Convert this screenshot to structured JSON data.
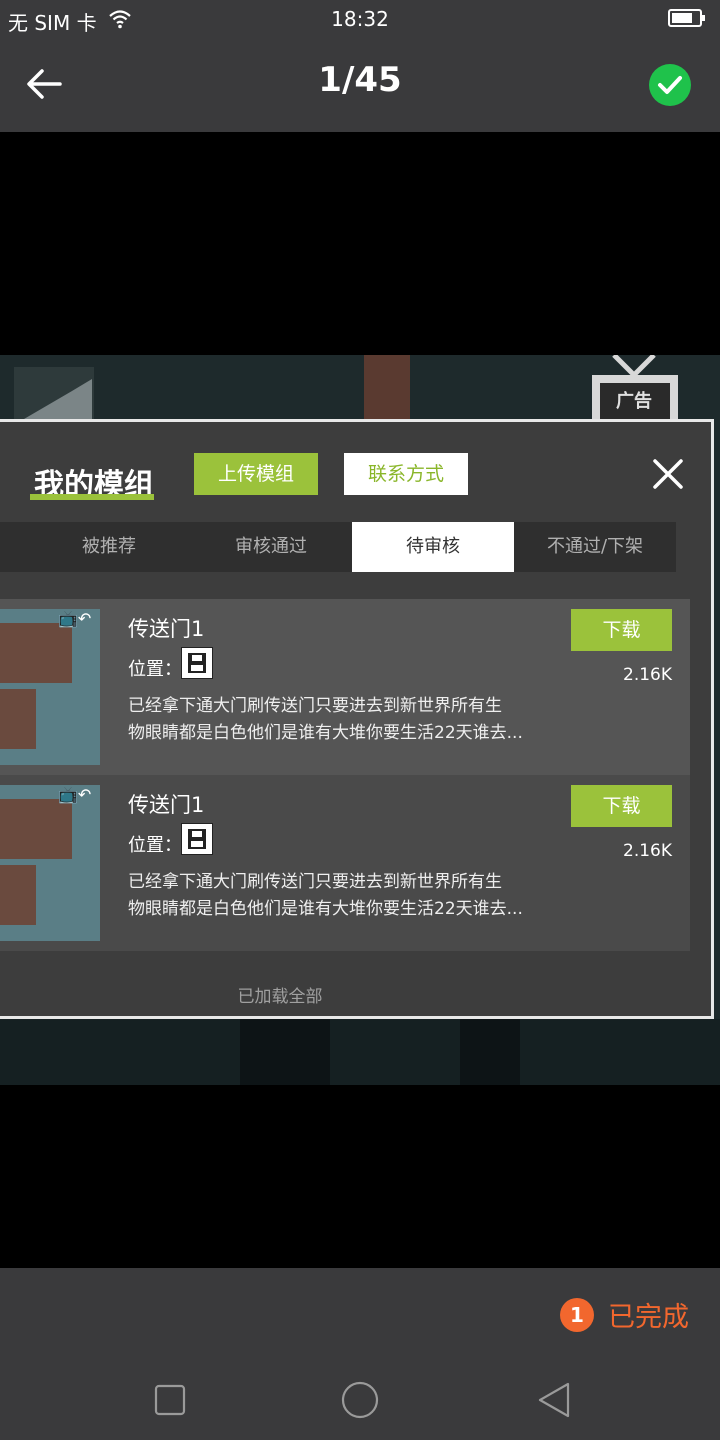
{
  "status_bar": {
    "carrier": "无 SIM 卡",
    "time": "18:32"
  },
  "header": {
    "counter": "1/45"
  },
  "panel": {
    "title": "我的模组",
    "upload_button": "上传模组",
    "contact_button": "联系方式",
    "tabs": [
      {
        "label": "被推荐"
      },
      {
        "label": "审核通过"
      },
      {
        "label": "待审核",
        "active": true
      },
      {
        "label": "不通过/下架"
      }
    ],
    "items": [
      {
        "name": "传送门1",
        "location_label": "位置：",
        "description_line1": "已经拿下通大门刷传送门只要进去到新世界所有生",
        "description_line2": "物眼睛都是白色他们是谁有大堆你要生活22天谁去...",
        "download_label": "下载",
        "size": "2.16K"
      },
      {
        "name": "传送门1",
        "location_label": "位置：",
        "description_line1": "已经拿下通大门刷传送门只要进去到新世界所有生",
        "description_line2": "物眼睛都是白色他们是谁有大堆你要生活22天谁去...",
        "download_label": "下载",
        "size": "2.16K"
      }
    ],
    "footer": "已加载全部"
  },
  "bottom": {
    "done_count": "1",
    "done_label": "已完成"
  },
  "colors": {
    "accent_green": "#9bc23b",
    "done_orange": "#f2672e",
    "check_green": "#1fc24b"
  }
}
